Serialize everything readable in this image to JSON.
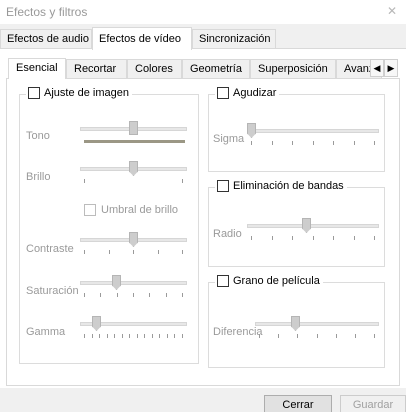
{
  "window": {
    "title": "Efectos y filtros",
    "close_icon": "close-icon"
  },
  "main_tabs": [
    {
      "label": "Efectos de audio",
      "active": false
    },
    {
      "label": "Efectos de vídeo",
      "active": true
    },
    {
      "label": "Sincronización",
      "active": false
    }
  ],
  "sub_tabs": [
    {
      "label": "Esencial",
      "active": true
    },
    {
      "label": "Recortar",
      "active": false
    },
    {
      "label": "Colores",
      "active": false
    },
    {
      "label": "Geometría",
      "active": false
    },
    {
      "label": "Superposición",
      "active": false
    },
    {
      "label": "Avanzado",
      "active": false
    }
  ],
  "image_adjust": {
    "label": "Ajuste de imagen",
    "checked": false,
    "rows": {
      "tono": {
        "label": "Tono",
        "value": 0.5
      },
      "brillo": {
        "label": "Brillo",
        "value": 0.5
      },
      "umbral": {
        "label": "Umbral de brillo",
        "checked": false
      },
      "contraste": {
        "label": "Contraste",
        "value": 0.5
      },
      "saturacion": {
        "label": "Saturación",
        "value": 0.33
      },
      "gamma": {
        "label": "Gamma",
        "value": 0.12
      }
    }
  },
  "sharpen": {
    "label": "Agudizar",
    "checked": false,
    "param": {
      "label": "Sigma",
      "value": 0.0
    }
  },
  "banding": {
    "label": "Eliminación de bandas",
    "checked": false,
    "param": {
      "label": "Radio",
      "value": 0.45
    }
  },
  "grain": {
    "label": "Grano de película",
    "checked": false,
    "param": {
      "label": "Diferencia",
      "value": 0.31
    }
  },
  "buttons": {
    "close": "Cerrar",
    "save": "Guardar"
  }
}
